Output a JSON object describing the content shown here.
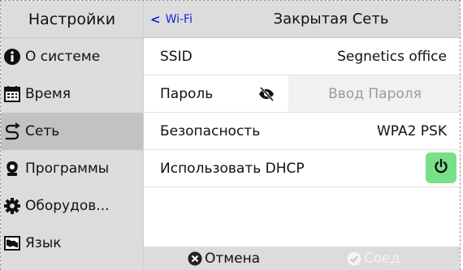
{
  "sidebar": {
    "title": "Настройки",
    "items": [
      {
        "label": "О системе",
        "icon": "info-icon"
      },
      {
        "label": "Время",
        "icon": "calendar-icon"
      },
      {
        "label": "Сеть",
        "icon": "network-icon",
        "active": true
      },
      {
        "label": "Программы",
        "icon": "apps-icon"
      },
      {
        "label": "Оборудов...",
        "icon": "gear-icon"
      },
      {
        "label": "Язык",
        "icon": "map-icon"
      }
    ]
  },
  "header": {
    "back_label": "Wi-Fi",
    "title": "Закрытая Сеть"
  },
  "rows": {
    "ssid_label": "SSID",
    "ssid_value": "Segnetics office",
    "password_label": "Пароль",
    "password_placeholder": "Ввод Пароля",
    "security_label": "Безопасность",
    "security_value": "WPA2 PSK",
    "dhcp_label": "Использовать DHCP"
  },
  "footer": {
    "cancel_label": "Отмена",
    "connect_label": "Соед."
  },
  "colors": {
    "back_link": "#1a23d6",
    "toggle_on": "#79e08a",
    "sidebar_bg": "#dcdcdc",
    "active_item_bg": "#c2c2c2"
  }
}
